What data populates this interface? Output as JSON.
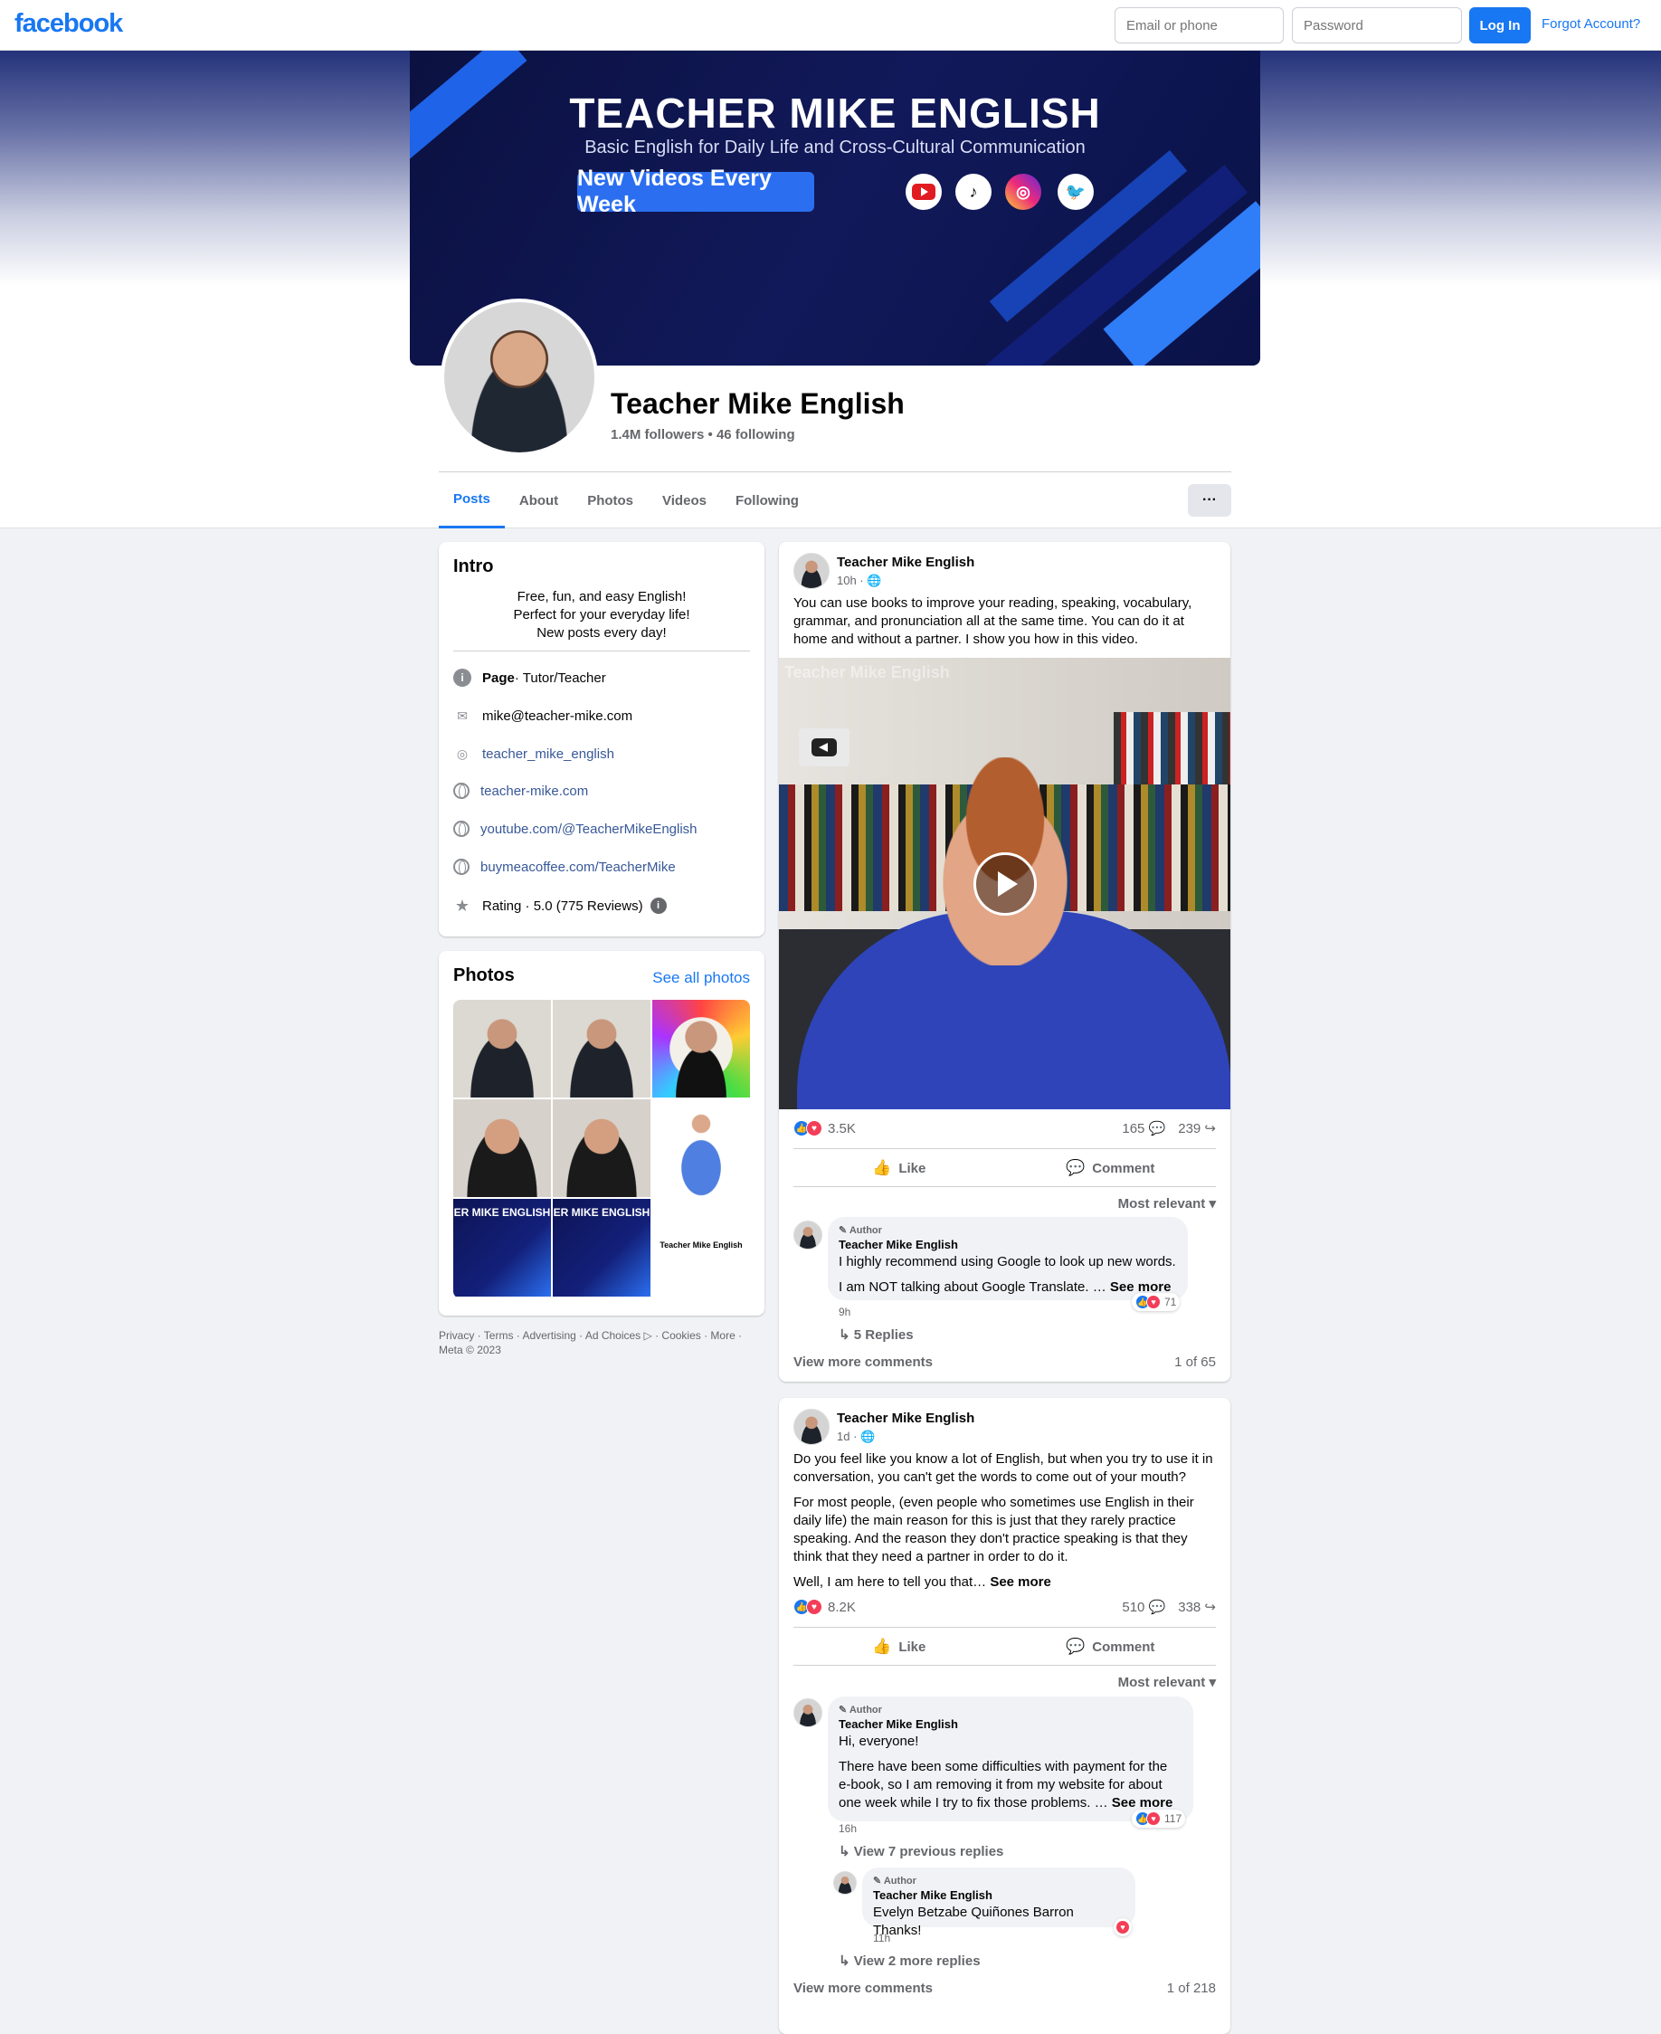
{
  "topbar": {
    "logo": "facebook",
    "email_placeholder": "Email or phone",
    "password_placeholder": "Password",
    "login_label": "Log In",
    "forgot_label": "Forgot Account?"
  },
  "cover": {
    "title": "TEACHER MIKE ENGLISH",
    "subtitle": "Basic English for Daily Life and Cross-Cultural Communication",
    "button": "New Videos Every Week"
  },
  "profile": {
    "name": "Teacher Mike English",
    "followers": "1.4M followers • 46 following"
  },
  "tabs": [
    "Posts",
    "About",
    "Photos",
    "Videos",
    "Following"
  ],
  "more_label": "···",
  "intro": {
    "title": "Intro",
    "bio": [
      "Free, fun, and easy English!",
      "Perfect for your everyday life!",
      "New posts every day!"
    ],
    "page_label": "Page",
    "page_category": " · Tutor/Teacher",
    "email": "mike@teacher-mike.com",
    "instagram": "teacher_mike_english",
    "website1": "teacher-mike.com",
    "website2": "youtube.com/@TeacherMikeEnglish",
    "website3": "buymeacoffee.com/TeacherMike",
    "rating": "Rating · 5.0 (775 Reviews)"
  },
  "photos": {
    "title": "Photos",
    "see_all": "See all photos",
    "thumb_caption_1": "HER MIKE ENGLISH",
    "thumb_caption_2": "HER MIKE ENGLISH",
    "thumb_caption_3": "Teacher Mike English"
  },
  "footer": "Privacy · Terms · Advertising · Ad Choices ▷ · Cookies · More · Meta © 2023",
  "post1": {
    "author": "Teacher Mike English",
    "time": "10h · 🌐",
    "text": "You can use books to improve your reading, speaking, vocabulary, grammar, and pronunciation all at the same time. You can do it at home and without a partner. I show you how in this video.",
    "video_watermark": "Teacher Mike English",
    "reactions": "3.5K",
    "comments": "165 💬",
    "shares": "239 ↪",
    "like": "Like",
    "comment": "Comment",
    "most_relevant": "Most relevant ▾",
    "c1_badge": "✎ Author",
    "c1_name": "Teacher Mike English",
    "c1_text1": "I highly recommend using Google to look up new words.",
    "c1_text2": "I am NOT talking about Google Translate. … ",
    "see_more": "See more",
    "c1_time": "9h",
    "c1_reacts": "71",
    "c1_replies": "↳ 5 Replies",
    "view_more": "View more comments",
    "count": "1 of 65"
  },
  "post2": {
    "author": "Teacher Mike English",
    "time": "1d · 🌐",
    "p1": "Do you feel like you know a lot of English, but when you try to use it in conversation, you can't get the words to come out of your mouth?",
    "p2": "For most people, (even people who sometimes use English in their daily life) the main reason for this is just that they rarely practice speaking. And the reason they don't practice speaking is that they think that they need a partner in order to do it.",
    "p3": "Well, I am here to tell you that… ",
    "see_more": "See more",
    "reactions": "8.2K",
    "comments": "510 💬",
    "shares": "338 ↪",
    "like": "Like",
    "comment": "Comment",
    "most_relevant": "Most relevant ▾",
    "c1_badge": "✎ Author",
    "c1_name": "Teacher Mike English",
    "c1_text1": "Hi, everyone!",
    "c1_text2": "There have been some difficulties with payment for the e-book, so I am removing it from my website for about one week while I try to fix those problems. … ",
    "c1_time": "16h",
    "c1_reacts": "117",
    "prev_replies": "↳ View 7 previous replies",
    "r1_badge": "✎ Author",
    "r1_name": "Teacher Mike English",
    "r1_text": "Evelyn Betzabe Quiñones Barron Thanks!",
    "r1_time": "11h",
    "more_replies": "↳ View 2 more replies",
    "view_more": "View more comments",
    "count": "1 of 218"
  }
}
